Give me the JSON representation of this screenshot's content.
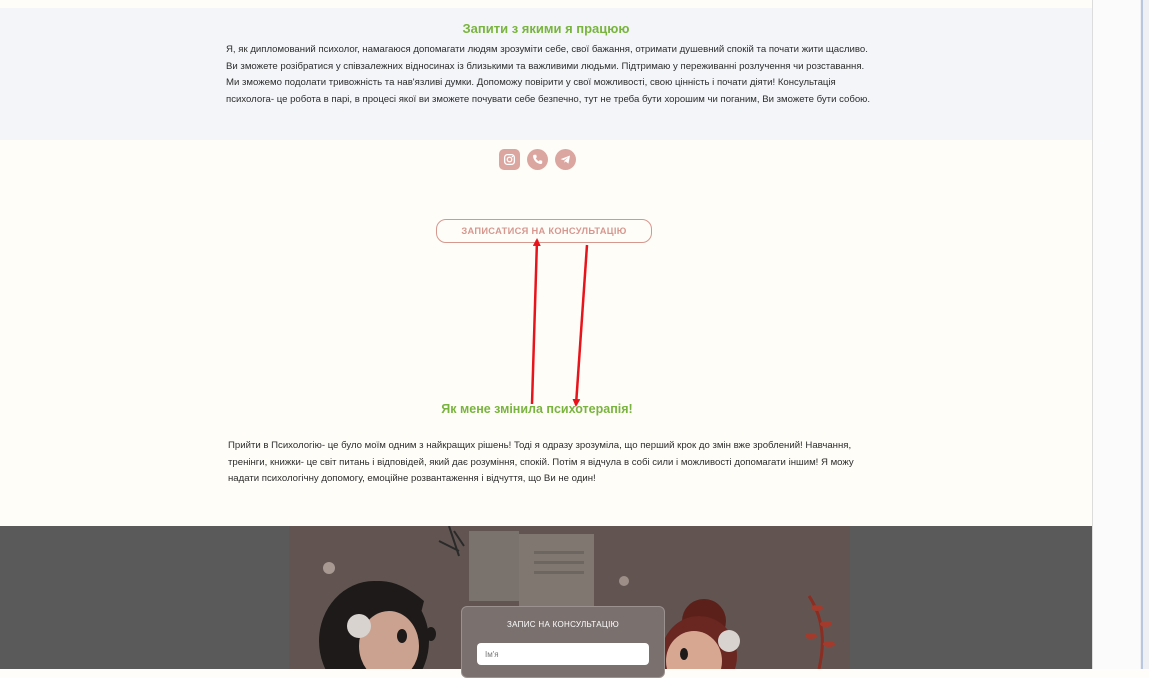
{
  "requests_section": {
    "title": "Запити з якими я працюю",
    "text": "Я, як дипломований психолог, намагаюся допомагати людям зрозуміти себе, свої бажання, отримати душевний спокій та почати жити щасливо. Ви зможете розібратися у співзалежних відносинах із близькими та важливими людьми. Підтримаю у переживанні розлучення чи розставання. Ми зможемо подолати тривожність та нав'язливі думки. Допоможу повірити у свої можливості, свою цінність і почати діяти! Консультація психолога- це робота в парі, в процесі якої ви зможете почувати себе безпечно, тут не треба бути хорошим чи поганим, Ви зможете бути собою."
  },
  "socials": [
    {
      "icon": "instagram-icon"
    },
    {
      "icon": "phone-icon"
    },
    {
      "icon": "telegram-icon"
    }
  ],
  "cta_label": "ЗАПИСАТИСЯ НА КОНСУЛЬТАЦІЮ",
  "story_section": {
    "title": "Як мене змінила психотерапія!",
    "text": "Прийти в Психологію- це було моїм одним з найкращих рішень! Тоді я одразу зрозуміла, що перший крок до змін вже зроблений! Навчання, тренінги, книжки- це світ питань і відповідей, який дає розуміння, спокій. Потім я відчула в собі сили і можливості допомагати іншим! Я можу надати психологічну допомогу, емоційне розвантаження і відчуття, що Ви не один!"
  },
  "booking_form": {
    "title": "ЗАПИС НА КОНСУЛЬТАЦІЮ",
    "name_placeholder": "Ім'я"
  },
  "colors": {
    "accent_green": "#79b43e",
    "accent_pink": "#d6978f",
    "annotation_red": "#e8141b"
  }
}
